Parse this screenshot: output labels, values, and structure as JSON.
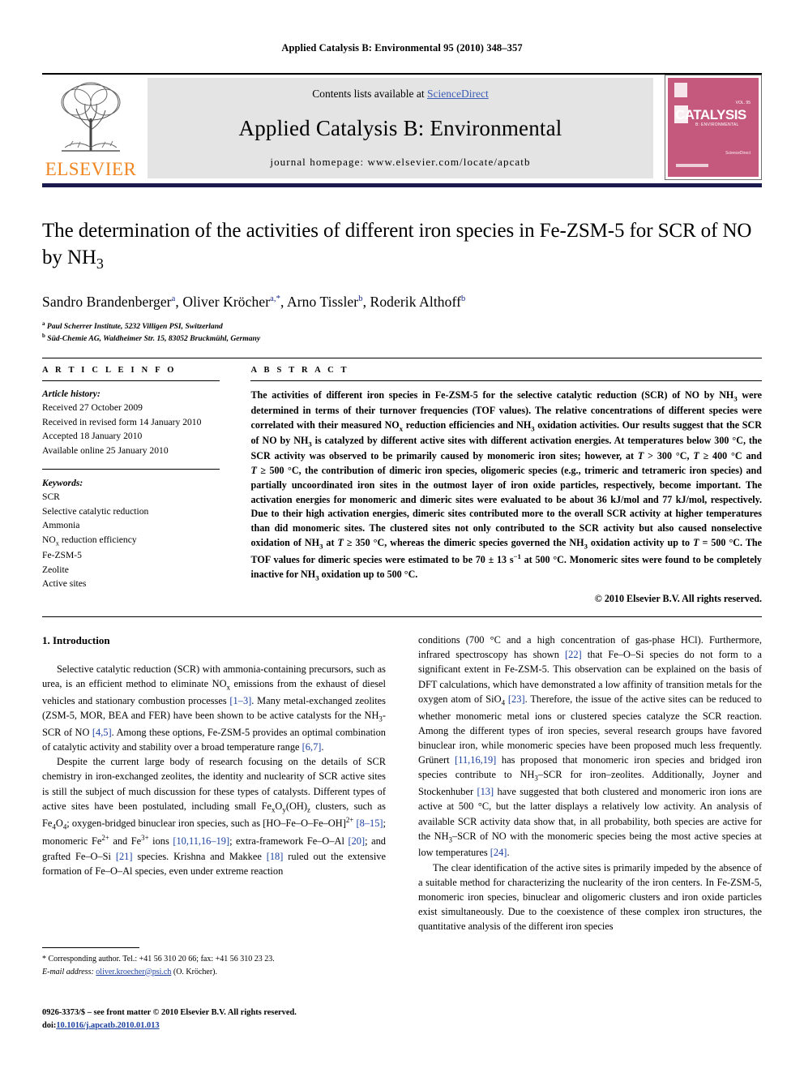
{
  "running_head": "Applied Catalysis B: Environmental 95 (2010) 348–357",
  "masthead": {
    "publisher_wordmark": "ELSEVIER",
    "contents_prefix": "Contents lists available at ",
    "sciencedirect": "ScienceDirect",
    "journal_title": "Applied Catalysis B: Environmental",
    "homepage_line": "journal homepage: www.elsevier.com/locate/apcatb",
    "cover": {
      "title": "CATALYSIS",
      "subtitle": "B: ENVIRONMENTAL",
      "volume_label": "VOL. 95",
      "publisher_note": "ScienceDirect",
      "accent_color": "#c4597d"
    },
    "accent_orange": "#F08521",
    "link_blue": "#3b5bb5",
    "rule_navy": "#1a1a4e"
  },
  "article": {
    "title_part1": "The determination of the activities of different iron species in Fe-ZSM-5 for SCR of NO by NH",
    "title_sub": "3",
    "authors_html": "Sandro Brandenberger a, Oliver Kröcher a,*, Arno Tissler b, Roderik Althoff b",
    "affiliation_a": "Paul Scherrer Institute, 5232 Villigen PSI, Switzerland",
    "affiliation_b": "Süd-Chemie AG, Waldheimer Str. 15, 83052 Bruckmühl, Germany"
  },
  "info": {
    "heading": "A R T I C L E   I N F O",
    "history_title": "Article history:",
    "history": [
      "Received 27 October 2009",
      "Received in revised form 14 January 2010",
      "Accepted 18 January 2010",
      "Available online 25 January 2010"
    ],
    "keywords_title": "Keywords:",
    "keywords": [
      "SCR",
      "Selective catalytic reduction",
      "Ammonia",
      "NOx reduction efficiency",
      "Fe-ZSM-5",
      "Zeolite",
      "Active sites"
    ]
  },
  "abstract": {
    "heading": "A B S T R A C T",
    "copyright": "© 2010 Elsevier B.V. All rights reserved."
  },
  "intro": {
    "section_title": "1. Introduction"
  },
  "footnote": {
    "corresponding": "* Corresponding author. Tel.: +41 56 310 20 66; fax: +41 56 310 23 23.",
    "email_label": "E-mail address:",
    "email": "oliver.kroecher@psi.ch",
    "email_suffix": "(O. Kröcher)."
  },
  "page_footer": {
    "front_matter": "0926-3373/$ – see front matter © 2010 Elsevier B.V. All rights reserved.",
    "doi_label": "doi:",
    "doi": "10.1016/j.apcatb.2010.01.013"
  }
}
